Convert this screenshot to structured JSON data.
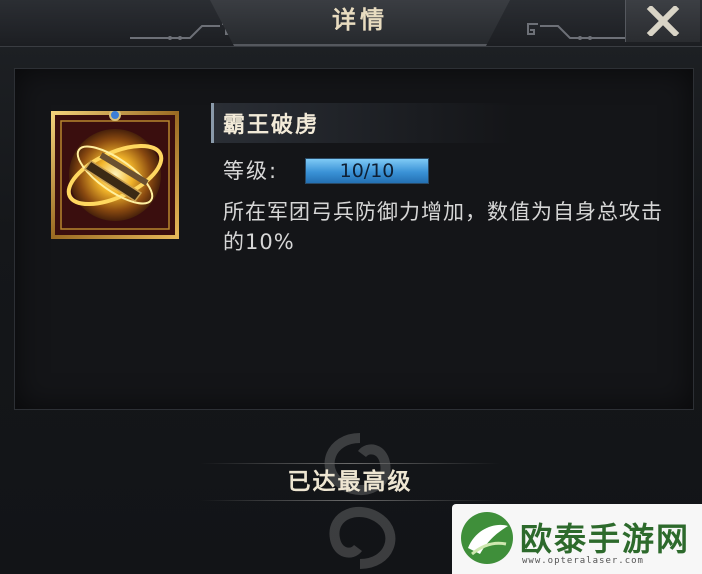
{
  "header": {
    "title": "详情",
    "close_icon": "close-x-icon"
  },
  "skill": {
    "icon": "golden-bow-skill-icon",
    "name": "霸王破虏",
    "level_label": "等级:",
    "level_text": "10/10",
    "level_fraction": 1.0,
    "description": "所在军团弓兵防御力增加，数值为自身总攻击的10%"
  },
  "footer": {
    "status_text": "已达最高级",
    "emblem": "dragon-emblem-icon"
  },
  "watermark": {
    "brand": "欧泰手游网",
    "url": "www.opteralaser.com",
    "logo": "leaf-logo-icon"
  },
  "colors": {
    "level_fill": "#3a92d6",
    "title_text": "#e8dcc0",
    "watermark_green": "#2d6a2c"
  }
}
